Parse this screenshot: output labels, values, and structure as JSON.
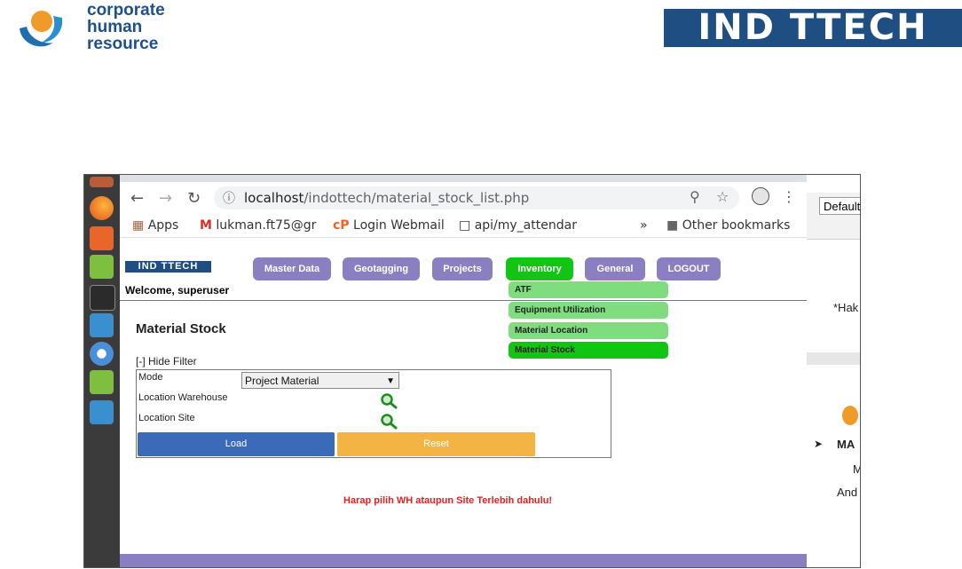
{
  "header": {
    "chr_logo_text": [
      "corporate",
      "human",
      "resource"
    ],
    "indottech_logo": "IND TTECH"
  },
  "browser": {
    "url_host": "localhost",
    "url_path": "/indottech/material_stock_list.php",
    "bookmarks": [
      "Apps",
      "lukman.ft75@gr",
      "Login Webmail",
      "api/my_attendar"
    ],
    "overflow": "»",
    "other_bookmarks": "Other bookmarks"
  },
  "site": {
    "logo": "IND TTECH",
    "welcome": "Welcome, superuser",
    "menu": [
      "Master Data",
      "Geotagging",
      "Projects",
      "Inventory",
      "General",
      "LOGOUT"
    ],
    "inventory_dropdown": [
      "ATF",
      "Equipment Utilization",
      "Material Location",
      "Material Stock"
    ]
  },
  "content": {
    "title": "Material Stock",
    "hide_filter": "[-] Hide Filter",
    "mode_label": "Mode",
    "mode_value": "Project Material",
    "location_warehouse_label": "Location Warehouse",
    "location_site_label": "Location Site",
    "load_button": "Load",
    "reset_button": "Reset",
    "warning": "Harap pilih WH ataupun Site Terlebih dahulu!"
  },
  "behind_window": {
    "default": "Default",
    "hak": "*Hak",
    "mat": "MA",
    "m": "M",
    "and": "And"
  },
  "colors": {
    "menu": "#8a7fc1",
    "active_green": "#12c512",
    "dropdown_green": "#7fdc7f",
    "load_blue": "#3a6ab8",
    "reset_orange": "#f3b443",
    "warning_red": "#e81e1e"
  }
}
